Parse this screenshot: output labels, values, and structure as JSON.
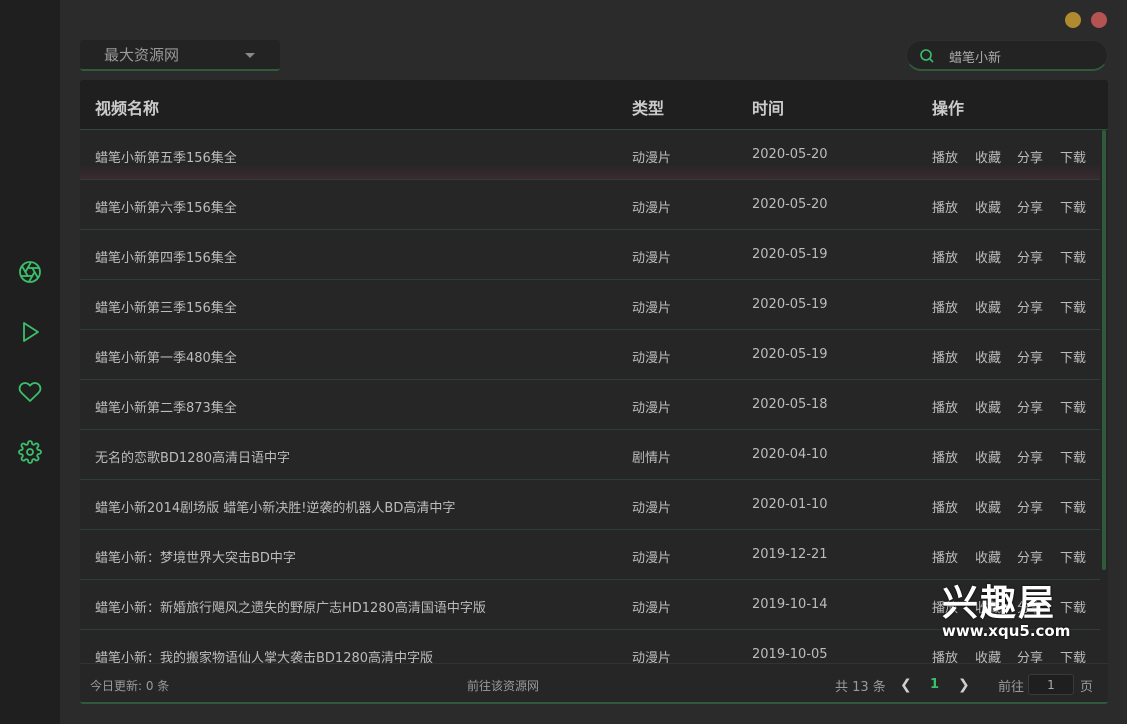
{
  "window": {
    "minimize_color": "#b08a2e",
    "close_color": "#b55252"
  },
  "colors": {
    "accent": "#2f5a3c",
    "accent_bright": "#3bbf6a",
    "background": "#2b2b2b",
    "sidebar": "#1f1f1f"
  },
  "sidebar": {
    "icons": [
      "aperture-icon",
      "play-icon",
      "heart-icon",
      "gear-icon"
    ]
  },
  "source_select": {
    "value": "最大资源网"
  },
  "search": {
    "value": "蜡笔小新"
  },
  "table": {
    "headers": {
      "name": "视频名称",
      "type": "类型",
      "time": "时间",
      "ops": "操作"
    },
    "actions": [
      "播放",
      "收藏",
      "分享",
      "下载"
    ],
    "rows": [
      {
        "name": "蜡笔小新第五季156集全",
        "type": "动漫片",
        "time": "2020-05-20"
      },
      {
        "name": "蜡笔小新第六季156集全",
        "type": "动漫片",
        "time": "2020-05-20"
      },
      {
        "name": "蜡笔小新第四季156集全",
        "type": "动漫片",
        "time": "2020-05-19"
      },
      {
        "name": "蜡笔小新第三季156集全",
        "type": "动漫片",
        "time": "2020-05-19"
      },
      {
        "name": "蜡笔小新第一季480集全",
        "type": "动漫片",
        "time": "2020-05-19"
      },
      {
        "name": "蜡笔小新第二季873集全",
        "type": "动漫片",
        "time": "2020-05-18"
      },
      {
        "name": "无名的恋歌BD1280高清日语中字",
        "type": "剧情片",
        "time": "2020-04-10"
      },
      {
        "name": "蜡笔小新2014剧场版 蜡笔小新决胜!逆袭的机器人BD高清中字",
        "type": "动漫片",
        "time": "2020-01-10"
      },
      {
        "name": "蜡笔小新：梦境世界大突击BD中字",
        "type": "动漫片",
        "time": "2019-12-21"
      },
      {
        "name": "蜡笔小新：新婚旅行飓风之遗失的野原广志HD1280高清国语中字版",
        "type": "动漫片",
        "time": "2019-10-14"
      },
      {
        "name": "蜡笔小新：我的搬家物语仙人掌大袭击BD1280高清中字版",
        "type": "动漫片",
        "time": "2019-10-05"
      }
    ]
  },
  "footer": {
    "today_update": "今日更新: 0 条",
    "goto_source": "前往该资源网",
    "total": "共 13 条",
    "current_page": "1",
    "goto_label": "前往",
    "goto_value": "1",
    "page_unit": "页"
  },
  "watermark": {
    "big": "兴趣屋",
    "small": "www.xqu5.com"
  }
}
